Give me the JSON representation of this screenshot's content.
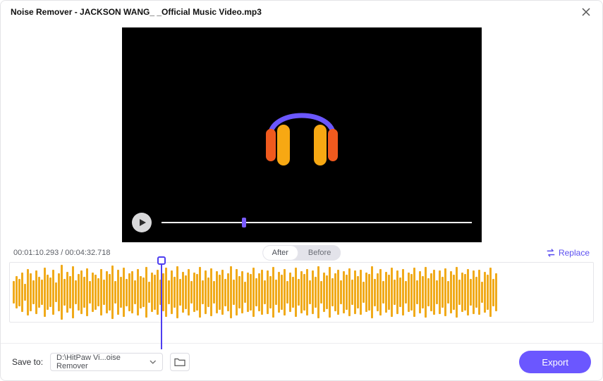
{
  "window": {
    "title": "Noise Remover - JACKSON WANG_ _Official Music Video.mp3"
  },
  "player": {
    "current_time": "00:01:10.293",
    "separator": "/",
    "total_time": "00:04:32.718",
    "progress_percent": 26
  },
  "toggle": {
    "after": "After",
    "before": "Before",
    "active": "after"
  },
  "actions": {
    "replace": "Replace"
  },
  "footer": {
    "save_to_label": "Save to:",
    "save_path": "D:\\HitPaw Vi...oise Remover",
    "export": "Export"
  },
  "icons": {
    "close": "close-icon",
    "play": "play-icon",
    "swap": "swap-icon",
    "chevron_down": "chevron-down-icon",
    "folder": "folder-icon",
    "headphones": "headphones-icon"
  },
  "colors": {
    "accent": "#6b57ff",
    "waveform": "#f0aa1a",
    "headband": "#6b57ff",
    "earcup": "#f7a813",
    "earcup_outer": "#f05a1e"
  },
  "waveform": {
    "samples": [
      28,
      42,
      35,
      50,
      22,
      60,
      48,
      30,
      55,
      40,
      33,
      62,
      45,
      38,
      58,
      26,
      49,
      70,
      34,
      52,
      41,
      66,
      30,
      47,
      55,
      39,
      61,
      28,
      50,
      44,
      36,
      59,
      32,
      53,
      46,
      68,
      29,
      57,
      40,
      63,
      35,
      48,
      54,
      31,
      60,
      42,
      37,
      65,
      27,
      51,
      45,
      58,
      33,
      49,
      62,
      30,
      56,
      40,
      67,
      34,
      52,
      43,
      59,
      28,
      50,
      46,
      64,
      31,
      55,
      38,
      61,
      29,
      53,
      44,
      57,
      35,
      48,
      66,
      32,
      60,
      41,
      54,
      27,
      51,
      47,
      63,
      36,
      49,
      58,
      30,
      56,
      42,
      65,
      33,
      52,
      45,
      60,
      28,
      50,
      39,
      62,
      34,
      54,
      46,
      59,
      31,
      55,
      40,
      67,
      29,
      51,
      43,
      64,
      36,
      48,
      57,
      30,
      53,
      45,
      61,
      32,
      56,
      41,
      58,
      27,
      50,
      46,
      66,
      35,
      49,
      60,
      29,
      52,
      44,
      63,
      33,
      55,
      38,
      59,
      28,
      51,
      47,
      62,
      30,
      54,
      42,
      65,
      36,
      48,
      58,
      31,
      56,
      40,
      61,
      29,
      53,
      45,
      64,
      32,
      50,
      46,
      60,
      34,
      55,
      39,
      57,
      27,
      52,
      44,
      63,
      35,
      49
    ]
  }
}
